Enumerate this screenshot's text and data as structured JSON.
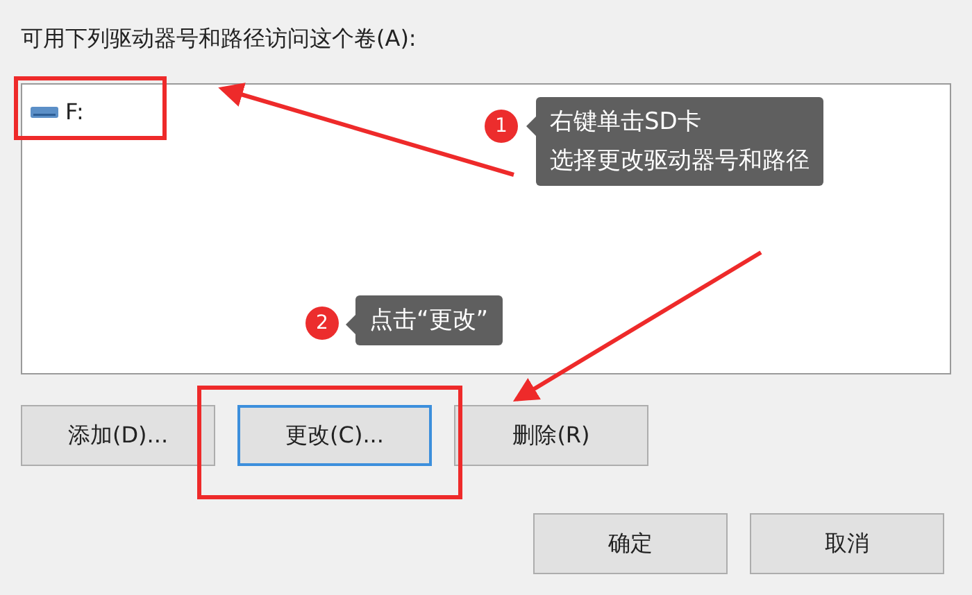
{
  "label": "可用下列驱动器号和路径访问这个卷(A):",
  "drives": [
    {
      "name": "F:"
    }
  ],
  "buttons": [
    {
      "label": "添加(D)...",
      "focused": false
    },
    {
      "label": "更改(C)...",
      "focused": true
    },
    {
      "label": "删除(R)",
      "focused": false
    }
  ],
  "dialog_buttons": [
    {
      "label": "确定"
    },
    {
      "label": "取消"
    }
  ],
  "annotations": [
    {
      "number": "1",
      "lines": [
        "右键单击SD卡",
        "选择更改驱动器号和路径"
      ]
    },
    {
      "number": "2",
      "lines": [
        "点击“更改”"
      ]
    }
  ]
}
